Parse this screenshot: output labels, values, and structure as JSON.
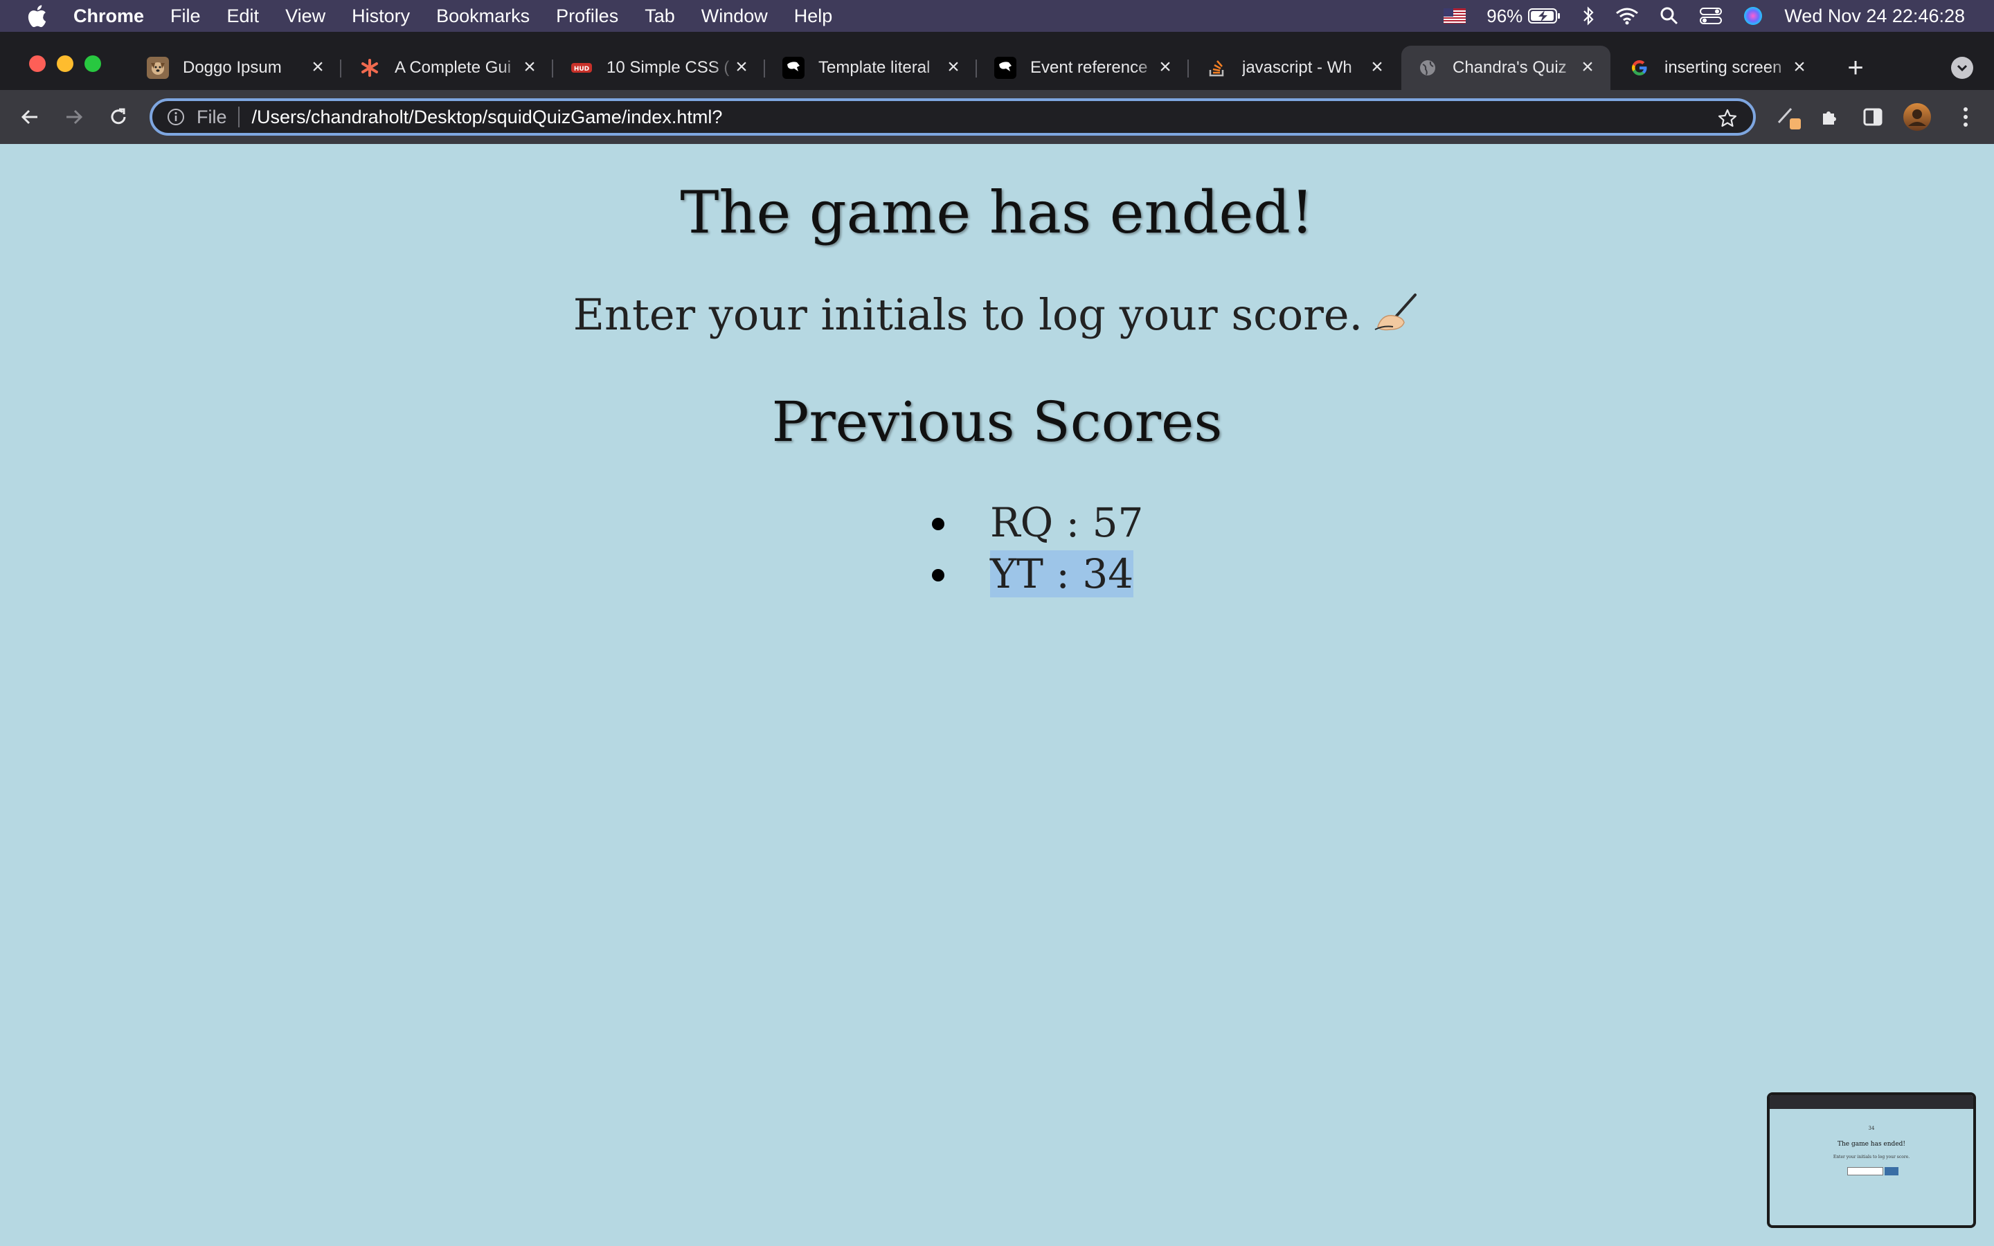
{
  "menubar": {
    "app_name": "Chrome",
    "items": [
      "File",
      "Edit",
      "View",
      "History",
      "Bookmarks",
      "Profiles",
      "Tab",
      "Window",
      "Help"
    ],
    "battery_percent": "96%",
    "clock": "Wed Nov 24  22:46:28"
  },
  "tabs": [
    {
      "title": "Doggo Ipsum",
      "favicon": "dog-icon",
      "active": false
    },
    {
      "title": "A Complete Gui",
      "favicon": "asterisk-icon",
      "active": false
    },
    {
      "title": "10 Simple CSS (",
      "favicon": "hud-icon",
      "active": false
    },
    {
      "title": "Template literal",
      "favicon": "mdn-icon",
      "active": false
    },
    {
      "title": "Event reference",
      "favicon": "mdn-icon",
      "active": false
    },
    {
      "title": "javascript - Wh",
      "favicon": "stackoverflow-icon",
      "active": false
    },
    {
      "title": "Chandra's Quiz",
      "favicon": "globe-icon",
      "active": true
    },
    {
      "title": "inserting screen",
      "favicon": "google-icon",
      "active": false
    }
  ],
  "omnibox": {
    "scheme": "File",
    "url": "/Users/chandraholt/Desktop/squidQuizGame/index.html?"
  },
  "page": {
    "heading": "The game has ended!",
    "prompt": "Enter your initials to log your score.",
    "prompt_emoji": "writing-hand-icon",
    "scores_heading": "Previous Scores",
    "scores": [
      {
        "text": "RQ : 57",
        "selected": false
      },
      {
        "text": "YT : 34",
        "selected": true
      }
    ]
  },
  "thumbnail": {
    "score": "34",
    "title": "The game has ended!",
    "prompt": "Enter your initials to log your score."
  },
  "colors": {
    "page_background": "#b6d8e2",
    "menubar": "#3f3b5a",
    "tabstrip": "#1e1e22",
    "toolbar": "#3a3a40",
    "omnibox_focus": "#7ea6e0",
    "selection": "#9dc5e8"
  }
}
